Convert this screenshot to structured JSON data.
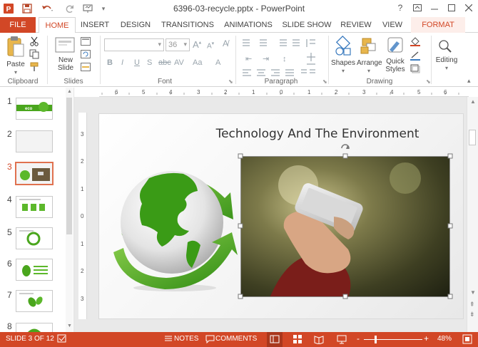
{
  "window": {
    "title": "6396-03-recycle.pptx - PowerPoint",
    "help": "?",
    "buttons": [
      "restore-ribbon",
      "minimize",
      "maximize",
      "close"
    ]
  },
  "quick_access": [
    "powerpoint-logo-icon",
    "save-icon",
    "undo-icon",
    "redo-icon",
    "customize-qat-icon"
  ],
  "tabs": [
    {
      "label": "FILE",
      "state": "file"
    },
    {
      "label": "HOME",
      "state": "active"
    },
    {
      "label": "INSERT",
      "state": ""
    },
    {
      "label": "DESIGN",
      "state": ""
    },
    {
      "label": "TRANSITIONS",
      "state": ""
    },
    {
      "label": "ANIMATIONS",
      "state": ""
    },
    {
      "label": "SLIDE SHOW",
      "state": ""
    },
    {
      "label": "REVIEW",
      "state": ""
    },
    {
      "label": "VIEW",
      "state": ""
    },
    {
      "label": "FORMAT",
      "state": "contextual"
    }
  ],
  "ribbon": {
    "clipboard": {
      "label": "Clipboard",
      "paste": "Paste"
    },
    "slides": {
      "label": "Slides",
      "new_slide_1": "New",
      "new_slide_2": "Slide"
    },
    "font": {
      "label": "Font",
      "font_name": "",
      "font_size": "36"
    },
    "paragraph": {
      "label": "Paragraph"
    },
    "drawing": {
      "label": "Drawing",
      "shapes": "Shapes",
      "arrange": "Arrange",
      "quick_styles_1": "Quick",
      "quick_styles_2": "Styles"
    },
    "editing": {
      "label": "Editing"
    }
  },
  "ruler": {
    "horizontal": [
      "6",
      "5",
      "4",
      "3",
      "2",
      "1",
      "0",
      "1",
      "2",
      "3",
      "4",
      "5",
      "6"
    ],
    "vertical": [
      "3",
      "2",
      "1",
      "0",
      "1",
      "2",
      "3"
    ]
  },
  "thumbnails": [
    {
      "num": "1",
      "selected": false,
      "text": "eco"
    },
    {
      "num": "2",
      "selected": false,
      "text": ""
    },
    {
      "num": "3",
      "selected": true,
      "text": ""
    },
    {
      "num": "4",
      "selected": false,
      "text": ""
    },
    {
      "num": "5",
      "selected": false,
      "text": ""
    },
    {
      "num": "6",
      "selected": false,
      "text": ""
    },
    {
      "num": "7",
      "selected": false,
      "text": ""
    },
    {
      "num": "8",
      "selected": false,
      "text": ""
    }
  ],
  "slide": {
    "title": "Technology And The Environment"
  },
  "status": {
    "slide_indicator": "SLIDE 3 OF 12",
    "notes": "NOTES",
    "comments": "COMMENTS",
    "zoom": "48%",
    "zoom_minus": "-",
    "zoom_plus": "+"
  },
  "colors": {
    "accent": "#d24726",
    "green": "#4aa61d"
  }
}
